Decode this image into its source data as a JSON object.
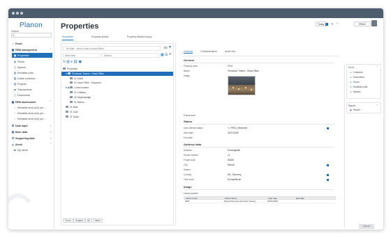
{
  "app": {
    "logo": "Planon"
  },
  "search": {
    "label": "Search",
    "icon": "search-icon"
  },
  "nav": {
    "home": "Home",
    "rem_management": "REM management",
    "rem_items": [
      "Properties",
      "Floors",
      "Spaces",
      "Rentable units",
      "Lease contracts",
      "Projects",
      "Transactions",
      "Documents"
    ],
    "rem_dashboards": "REM dashboards",
    "dash_items": [
      "Rentable area (m2) per ...",
      "Rentable area (m2) per ...",
      "Rentable area (m2) per ..."
    ],
    "data_input": "Data input",
    "base_data": "Base data",
    "supporting_data": "Supporting data",
    "alerts": "Alerts",
    "my_alerts": "My alerts"
  },
  "page": {
    "title": "Properties",
    "tabs": [
      "Properties",
      "Property details",
      "Property details history"
    ]
  },
  "topright": {
    "today": "Today",
    "help": "?",
    "user": "RRAS"
  },
  "left": {
    "filter_placeholder": "No filter - click to add or show filters",
    "select1": "Start date",
    "select2": "Search...",
    "tree_root": "Properties",
    "tree": [
      "*Emission Towers - Head Office",
      "01 Zuhal",
      "01 Head Office - Disposed",
      "Lumen towers",
      "01 Cintaras",
      "01 Kingfordedge",
      "01 Marlon",
      "01 Mids",
      "01 Dots",
      "01 Tokyo"
    ],
    "buttons": [
      "Count",
      "Expand",
      "All",
      "Items"
    ]
  },
  "detail": {
    "tabs": [
      "General",
      "Characteristics",
      "Audit info"
    ],
    "general_section": "General",
    "fields_general": [
      {
        "label": "Property code",
        "value": "0710"
      },
      {
        "label": "Name",
        "value": "*Emission Towers - Head Office"
      },
      {
        "label": "Image",
        "value": ""
      }
    ],
    "parent_label": "Parent level",
    "status_section": "Status",
    "fields_status": [
      {
        "label": "User-defined status",
        "value": "<> PR10_Reserved"
      },
      {
        "label": "Start date",
        "value": "01/01/2020"
      },
      {
        "label": "End date",
        "value": ""
      }
    ],
    "address_section": "Address data",
    "fields_address": [
      {
        "label": "Address",
        "value": "Freisinghalle"
      },
      {
        "label": "House number",
        "value": "12"
      },
      {
        "label": "Postal code",
        "value": "80469"
      },
      {
        "label": "City",
        "value": "Munich"
      },
      {
        "label": "District",
        "value": ""
      },
      {
        "label": "Country",
        "value": "DE, Germany"
      },
      {
        "label": "Time zone",
        "value": "Europe/Berlin"
      }
    ],
    "image_section": "Image",
    "linked_label": "Linked parcels",
    "table_headers": [
      "Parcel Code",
      "Parcel Name",
      "Start date",
      "End date"
    ],
    "table_rows": [
      [
        "0007",
        "Parcel land area Emission Towers",
        "01/01/2020",
        ""
      ]
    ]
  },
  "side": {
    "goto_title": "Go to",
    "goto_items": [
      "Contracts",
      "Documents",
      "Floors",
      "Rentable units",
      "Spaces"
    ],
    "report_title": "Report",
    "report_items": [
      "Report"
    ],
    "cancel": "Cancel"
  }
}
